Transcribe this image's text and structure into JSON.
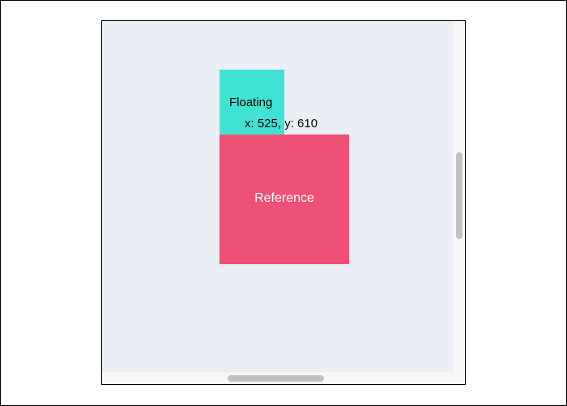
{
  "floating": {
    "label": "Floating",
    "color": "#41e2d3"
  },
  "reference": {
    "label": "Reference",
    "color": "#ef5176"
  },
  "coordinates": {
    "text": "x: 525, y: 610"
  },
  "viewport": {
    "background": "#eaeef5"
  }
}
